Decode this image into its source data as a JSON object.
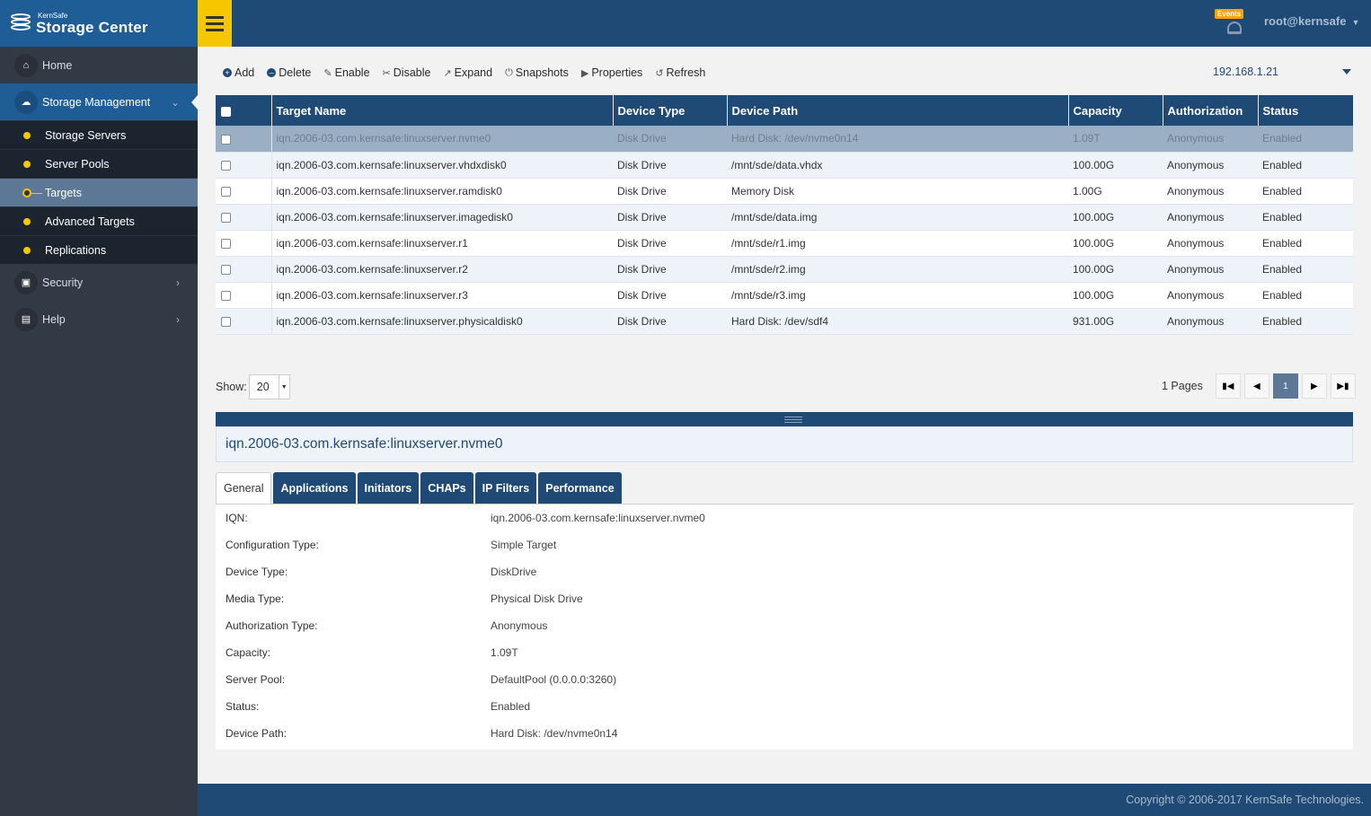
{
  "brand": {
    "small": "KernSafe",
    "name": "Storage Center"
  },
  "sidebar": {
    "items": [
      {
        "label": "Home",
        "icon": "home-icon"
      },
      {
        "label": "Storage Management",
        "icon": "cloud-icon"
      },
      {
        "label": "Security",
        "icon": "shield-icon"
      },
      {
        "label": "Help",
        "icon": "book-icon"
      }
    ],
    "submenu": [
      {
        "label": "Storage Servers"
      },
      {
        "label": "Server Pools"
      },
      {
        "label": "Targets"
      },
      {
        "label": "Advanced Targets"
      },
      {
        "label": "Replications"
      }
    ]
  },
  "topbar": {
    "events_badge": "Events",
    "user": "root@kernsafe"
  },
  "toolbar": {
    "add": "Add",
    "delete": "Delete",
    "enable": "Enable",
    "disable": "Disable",
    "expand": "Expand",
    "snapshots": "Snapshots",
    "properties": "Properties",
    "refresh": "Refresh",
    "server": "192.168.1.21"
  },
  "table": {
    "headers": {
      "name": "Target Name",
      "type": "Device Type",
      "path": "Device Path",
      "capacity": "Capacity",
      "auth": "Authorization",
      "status": "Status"
    },
    "rows": [
      {
        "name": "iqn.2006-03.com.kernsafe:linuxserver.nvme0",
        "type": "Disk Drive",
        "path": "Hard Disk: /dev/nvme0n14",
        "capacity": "1.09T",
        "auth": "Anonymous",
        "status": "Enabled"
      },
      {
        "name": "iqn.2006-03.com.kernsafe:linuxserver.vhdxdisk0",
        "type": "Disk Drive",
        "path": "/mnt/sde/data.vhdx",
        "capacity": "100.00G",
        "auth": "Anonymous",
        "status": "Enabled"
      },
      {
        "name": "iqn.2006-03.com.kernsafe:linuxserver.ramdisk0",
        "type": "Disk Drive",
        "path": "Memory Disk",
        "capacity": "1.00G",
        "auth": "Anonymous",
        "status": "Enabled"
      },
      {
        "name": "iqn.2006-03.com.kernsafe:linuxserver.imagedisk0",
        "type": "Disk Drive",
        "path": "/mnt/sde/data.img",
        "capacity": "100.00G",
        "auth": "Anonymous",
        "status": "Enabled"
      },
      {
        "name": "iqn.2006-03.com.kernsafe:linuxserver.r1",
        "type": "Disk Drive",
        "path": "/mnt/sde/r1.img",
        "capacity": "100.00G",
        "auth": "Anonymous",
        "status": "Enabled"
      },
      {
        "name": "iqn.2006-03.com.kernsafe:linuxserver.r2",
        "type": "Disk Drive",
        "path": "/mnt/sde/r2.img",
        "capacity": "100.00G",
        "auth": "Anonymous",
        "status": "Enabled"
      },
      {
        "name": "iqn.2006-03.com.kernsafe:linuxserver.r3",
        "type": "Disk Drive",
        "path": "/mnt/sde/r3.img",
        "capacity": "100.00G",
        "auth": "Anonymous",
        "status": "Enabled"
      },
      {
        "name": "iqn.2006-03.com.kernsafe:linuxserver.physicaldisk0",
        "type": "Disk Drive",
        "path": "Hard Disk: /dev/sdf4",
        "capacity": "931.00G",
        "auth": "Anonymous",
        "status": "Enabled"
      }
    ]
  },
  "pager": {
    "show_label": "Show:",
    "page_size": "20",
    "pages_label": "1 Pages",
    "current_page": "1"
  },
  "detail": {
    "title": "iqn.2006-03.com.kernsafe:linuxserver.nvme0",
    "tabs": [
      "General",
      "Applications",
      "Initiators",
      "CHAPs",
      "IP Filters",
      "Performance"
    ],
    "properties": [
      {
        "label": "IQN:",
        "value": "iqn.2006-03.com.kernsafe:linuxserver.nvme0"
      },
      {
        "label": "Configuration Type:",
        "value": "Simple Target"
      },
      {
        "label": "Device Type:",
        "value": "DiskDrive"
      },
      {
        "label": "Media Type:",
        "value": "Physical Disk Drive"
      },
      {
        "label": "Authorization Type:",
        "value": "Anonymous"
      },
      {
        "label": "Capacity:",
        "value": "1.09T"
      },
      {
        "label": "Server Pool:",
        "value": "DefaultPool (0.0.0.0:3260)"
      },
      {
        "label": "Status:",
        "value": "Enabled"
      },
      {
        "label": "Device Path:",
        "value": "Hard Disk: /dev/nvme0n14"
      }
    ]
  },
  "footer": {
    "copyright": "Copyright © 2006-2017 KernSafe Technologies."
  },
  "colors": {
    "primary": "#1f4a75",
    "accent": "#f6c700",
    "sidebar": "#323a45",
    "selected_row": "#9aaec4"
  }
}
